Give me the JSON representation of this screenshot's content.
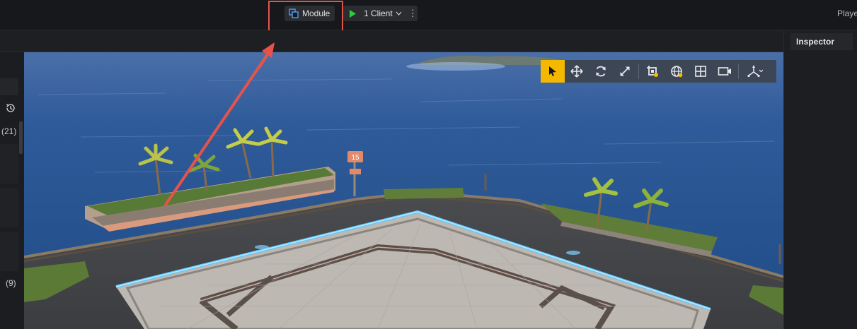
{
  "topbar": {
    "module_label": "Module",
    "client_label": "1 Client",
    "more_label": "⋮",
    "player_label": "Playe",
    "accent_play": "#2ecc40",
    "accent_module_icon": "#4a9eff",
    "highlight_color": "#e5534b"
  },
  "left_panel": {
    "count_top": "(21)",
    "count_bottom": "(9)"
  },
  "inspector": {
    "tab_label": "Inspector"
  },
  "toolbar": {
    "tools": [
      "select-icon",
      "move-icon",
      "rotate-icon",
      "scale-icon",
      "snap-icon",
      "world-local-icon",
      "layout-icon",
      "camera-icon",
      "axis-icon"
    ],
    "active_tool": "select-icon",
    "active_color": "#f5b800"
  },
  "scene": {
    "sign_text": "15"
  }
}
